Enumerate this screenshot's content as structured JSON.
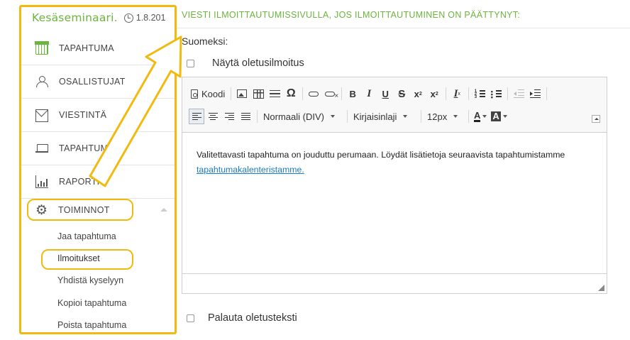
{
  "event": {
    "name": "Kesäseminaari.",
    "date": "1.8.201"
  },
  "sidebar": {
    "items": [
      {
        "label": "TAPAHTUMA",
        "icon": "calendar-icon"
      },
      {
        "label": "OSALLISTUJAT",
        "icon": "users-icon"
      },
      {
        "label": "VIESTINTÄ",
        "icon": "mail-icon"
      },
      {
        "label": "TAPAHTUMAS",
        "icon": "laptop-icon"
      },
      {
        "label": "RAPORTI",
        "icon": "bar-chart-icon"
      }
    ],
    "tools": {
      "label": "TOIMINNOT",
      "icon": "gear-icon"
    },
    "subitems": [
      {
        "label": "Jaa tapahtuma"
      },
      {
        "label": "Ilmoitukset"
      },
      {
        "label": "Yhdistä kyselyyn"
      },
      {
        "label": "Kopioi tapahtuma"
      },
      {
        "label": "Poista tapahtuma"
      }
    ],
    "active_subitem": "Ilmoitukset"
  },
  "main": {
    "section_title": "VIESTI ILMOITTAUTUMISSIVULLA, JOS ILMOITTAUTUMINEN ON PÄÄTTYNYT:",
    "language_label": "Suomeksi:",
    "show_default_label": "Näytä oletusilmoitus",
    "restore_default_label": "Palauta oletusteksti",
    "show_default_checked": false,
    "restore_default_checked": false
  },
  "editor": {
    "toolbar": {
      "source_label": "Koodi",
      "bold": "B",
      "italic": "I",
      "underline": "U",
      "strike": "S",
      "subscript_base": "x",
      "subscript_index": "2",
      "superscript_base": "x",
      "superscript_index": "2",
      "clear_format": "I",
      "clear_format_index": "x",
      "special_char": "Ω",
      "format_value": "Normaali (DIV)",
      "font_value": "Kirjaisinlaji",
      "size_value": "12px",
      "text_color": "A",
      "bg_color": "A"
    },
    "content_text": "Valitettavasti tapahtuma on jouduttu perumaan. Löydät lisätietoja seuraavista tapahtumistamme",
    "content_link": "tapahtumakalenteristamme."
  },
  "colors": {
    "accent_green": "#6cb33f",
    "highlight_yellow": "#f2b90f",
    "link_blue": "#1a7bbf"
  }
}
